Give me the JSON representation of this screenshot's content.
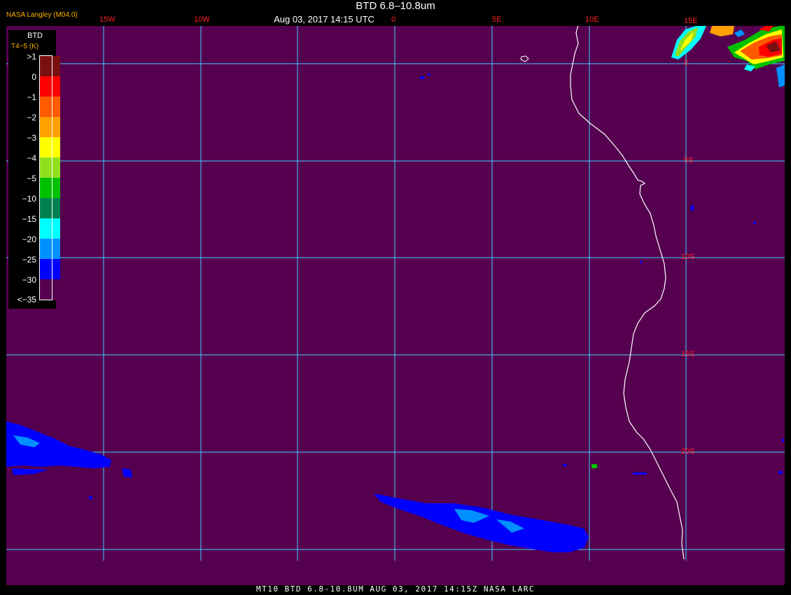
{
  "header": {
    "title": "BTD 6.8–10.8um",
    "datetime": "Aug 03, 2017 14:15 UTC",
    "agency": "NASA Langley (M04.0)"
  },
  "longitude_labels": [
    "15W",
    "10W",
    "0",
    "5E",
    "10E",
    "15E"
  ],
  "latitude_labels": [
    "0",
    "5S",
    "10S",
    "15S",
    "20S"
  ],
  "legend": {
    "title": "BTD",
    "units": "T4−5 (K)",
    "entries": [
      {
        "label": ">1",
        "color": "#7a1010"
      },
      {
        "label": "0",
        "color": "#ff0000"
      },
      {
        "label": "−1",
        "color": "#ff5a00"
      },
      {
        "label": "−2",
        "color": "#ffa000"
      },
      {
        "label": "−3",
        "color": "#ffff00"
      },
      {
        "label": "−4",
        "color": "#90e020"
      },
      {
        "label": "−5",
        "color": "#00c000"
      },
      {
        "label": "−10",
        "color": "#008050"
      },
      {
        "label": "−15",
        "color": "#00ffff"
      },
      {
        "label": "−20",
        "color": "#0090ff"
      },
      {
        "label": "−25",
        "color": "#0000ff"
      },
      {
        "label": "−30",
        "color": "#560050"
      },
      {
        "label": "<−35",
        "color": ""
      }
    ]
  },
  "colors": {
    "background": "#560050",
    "grid": "#40d0ff",
    "coastline": "#ffffff",
    "cold_cloud": "#0000ff",
    "label": "#ff2020"
  },
  "footer": "MT10  BTD 6.8-10.8UM   AUG 03, 2017 14:15Z   NASA LARC"
}
